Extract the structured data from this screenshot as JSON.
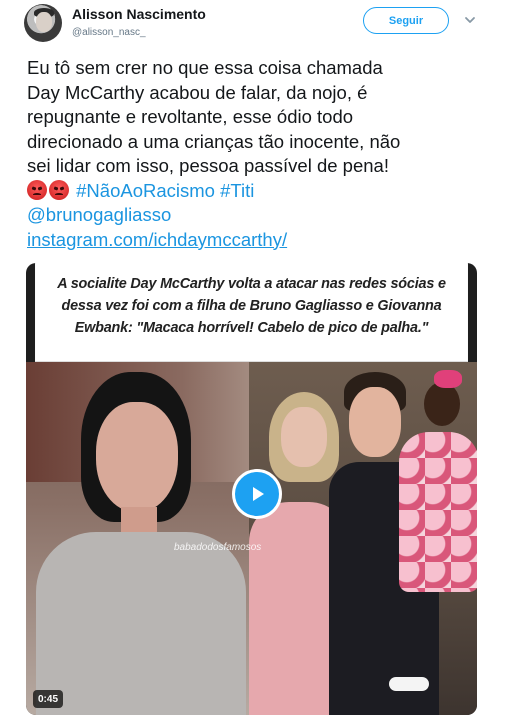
{
  "tweet": {
    "author": {
      "display_name": "Alisson Nascimento",
      "handle": "@alisson_nasc_"
    },
    "follow_label": "Seguir",
    "text_lines": [
      "Eu tô sem crer no que essa coisa chamada",
      "Day McCarthy acabou de falar, da nojo, é",
      "repugnante e revoltante, esse ódio todo",
      "direcionado a uma crianças tão inocente, não",
      "sei lidar com isso, pessoa passível de pena!"
    ],
    "hashtags": [
      "#NãoAoRacismo",
      "#Titi"
    ],
    "mention": "@brunogagliasso",
    "link": "instagram.com/ichdaymccarthy/",
    "media": {
      "caption_lines": [
        "A socialite Day McCarthy volta a atacar nas redes sócias e",
        "dessa vez foi com a filha de Bruno Gagliasso e Giovanna",
        "Ewbank: \"Macaca horrível! Cabelo de pico de palha.\""
      ],
      "watermark": "babadodosfamosos",
      "duration": "0:45"
    }
  },
  "colors": {
    "accent": "#1da1f2",
    "link": "#1b95e0",
    "text": "#14171a",
    "secondary": "#657786"
  },
  "icons": {
    "chevron": "chevron-down-icon",
    "play": "play-icon",
    "emoji": "pouting-face-emoji"
  }
}
